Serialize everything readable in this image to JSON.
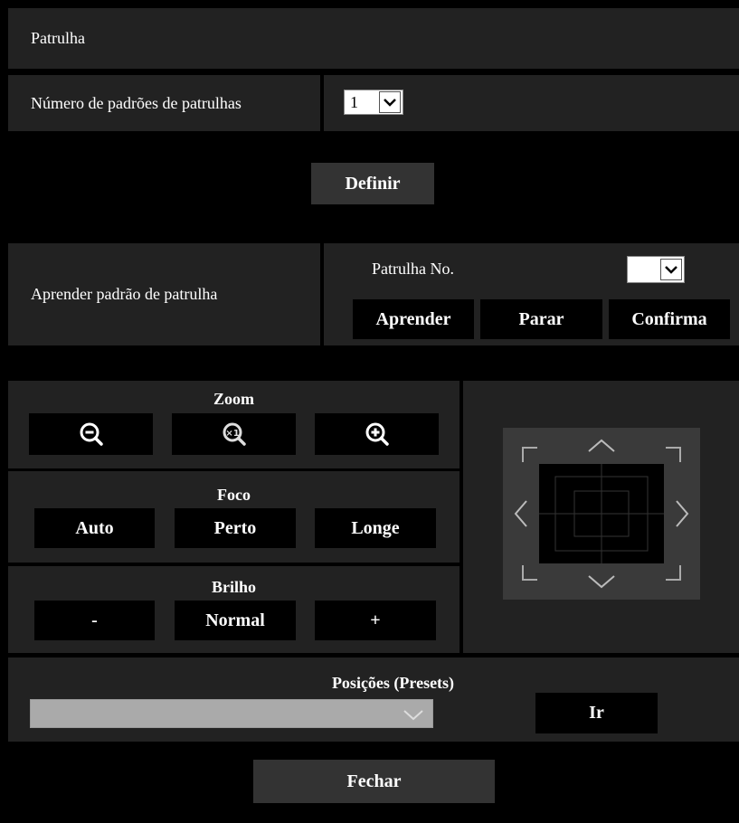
{
  "patrol": {
    "title": "Patrulha",
    "count_label": "Número de padrões de patrulhas",
    "count_value": "1",
    "set_button": "Definir",
    "learn_label": "Aprender padrão de patrulha",
    "patrol_no_label": "Patrulha No.",
    "patrol_no_value": "",
    "learn_button": "Aprender",
    "stop_button": "Parar",
    "confirm_button": "Confirma"
  },
  "zoom": {
    "title": "Zoom",
    "zoom_out_icon": "zoom-out-icon",
    "zoom_x1_icon": "zoom-x1-icon",
    "zoom_in_icon": "zoom-in-icon"
  },
  "focus": {
    "title": "Foco",
    "auto": "Auto",
    "near": "Perto",
    "far": "Longe"
  },
  "brightness": {
    "title": "Brilho",
    "minus": "-",
    "normal": "Normal",
    "plus": "+"
  },
  "presets": {
    "title": "Posições (Presets)",
    "selected": "",
    "go_button": "Ir"
  },
  "close_button": "Fechar",
  "colors": {
    "background": "#000000",
    "panel": "#222222",
    "button": "#000000",
    "button_dark": "#333333",
    "ptz_button": "#3a3a3a"
  }
}
